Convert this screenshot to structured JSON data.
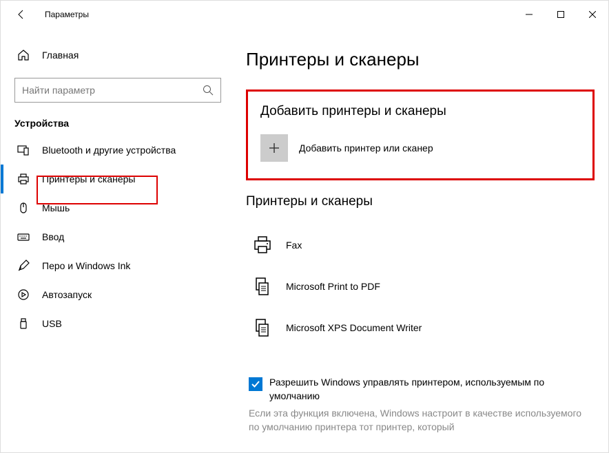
{
  "window": {
    "title": "Параметры"
  },
  "sidebar": {
    "home": "Главная",
    "search_placeholder": "Найти параметр",
    "category": "Устройства",
    "items": [
      {
        "label": "Bluetooth и другие устройства"
      },
      {
        "label": "Принтеры и сканеры"
      },
      {
        "label": "Мышь"
      },
      {
        "label": "Ввод"
      },
      {
        "label": "Перо и Windows Ink"
      },
      {
        "label": "Автозапуск"
      },
      {
        "label": "USB"
      }
    ]
  },
  "main": {
    "title": "Принтеры и сканеры",
    "add_section_title": "Добавить принтеры и сканеры",
    "add_button_label": "Добавить принтер или сканер",
    "list_section_title": "Принтеры и сканеры",
    "printers": [
      {
        "name": "Fax"
      },
      {
        "name": "Microsoft Print to PDF"
      },
      {
        "name": "Microsoft XPS Document Writer"
      }
    ],
    "checkbox_text": "Разрешить Windows управлять принтером, используемым по умолчанию",
    "help_text": "Если эта функция включена, Windows настроит в качестве используемого по умолчанию принтера тот принтер, который"
  }
}
